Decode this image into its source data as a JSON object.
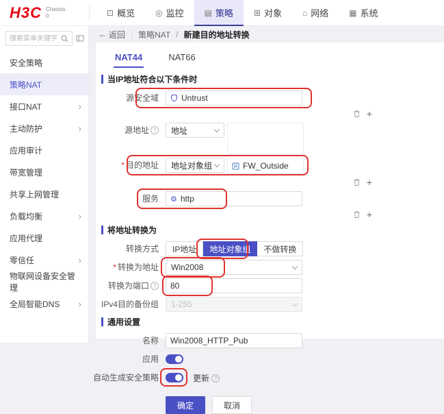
{
  "brand": {
    "logo": "H3C",
    "chassis_line1": "Chassis",
    "chassis_line2": "0"
  },
  "icons": {
    "plus": "+",
    "back_arrow": "←",
    "help": "?",
    "gear": "⚙",
    "chevron": "›"
  },
  "nav": {
    "items": [
      {
        "label": "概览",
        "glyph": "⊡"
      },
      {
        "label": "监控",
        "glyph": "◎"
      },
      {
        "label": "策略",
        "glyph": "▤"
      },
      {
        "label": "对象",
        "glyph": "⊞"
      },
      {
        "label": "网络",
        "glyph": "⌂"
      },
      {
        "label": "系统",
        "glyph": "▦"
      }
    ]
  },
  "sidebar": {
    "search_placeholder": "搜索菜单关键字",
    "items": [
      {
        "label": "安全策略"
      },
      {
        "label": "策略NAT"
      },
      {
        "label": "接口NAT"
      },
      {
        "label": "主动防护"
      },
      {
        "label": "应用审计"
      },
      {
        "label": "带宽管理"
      },
      {
        "label": "共享上网管理"
      },
      {
        "label": "负载均衡"
      },
      {
        "label": "应用代理"
      },
      {
        "label": "零信任"
      },
      {
        "label": "物联网设备安全管理"
      },
      {
        "label": "全局智能DNS"
      }
    ]
  },
  "breadcrumb": {
    "back": "返回",
    "divider": "|",
    "parent": "策略NAT",
    "slash": "/",
    "current": "新建目的地址转换"
  },
  "tabs": {
    "nat44": "NAT44",
    "nat66": "NAT66"
  },
  "form": {
    "required_mark": "*",
    "section_match": "当IP地址符合以下条件时",
    "src_zone": {
      "label": "源安全域",
      "value": "Untrust"
    },
    "src_addr": {
      "label": "源地址",
      "type": "地址"
    },
    "dst_addr": {
      "label": "目的地址",
      "type": "地址对象组",
      "value": "FW_Outside"
    },
    "service": {
      "label": "服务",
      "value": "http"
    },
    "section_translate": "将地址转换为",
    "method": {
      "label": "转换方式",
      "options": [
        "IP地址",
        "地址对象组",
        "不做转换"
      ],
      "selected": "地址对象组"
    },
    "to_addr": {
      "label": "转换为地址",
      "value": "Win2008"
    },
    "to_port": {
      "label": "转换为端口",
      "value": "80"
    },
    "backup": {
      "label": "IPv4目的备份组",
      "value": "1-255"
    },
    "section_general": "通用设置",
    "name": {
      "label": "名称",
      "value": "Win2008_HTTP_Pub"
    },
    "enable": {
      "label": "应用"
    },
    "auto_policy": {
      "label": "自动生成安全策略",
      "update_label": "更新"
    },
    "buttons": {
      "ok": "确定",
      "cancel": "取消"
    }
  },
  "colors": {
    "accent": "#4a50c4",
    "highlight": "#e0312e",
    "brand_red": "#e60012",
    "nav_active_bg": "#e8e8f8"
  }
}
